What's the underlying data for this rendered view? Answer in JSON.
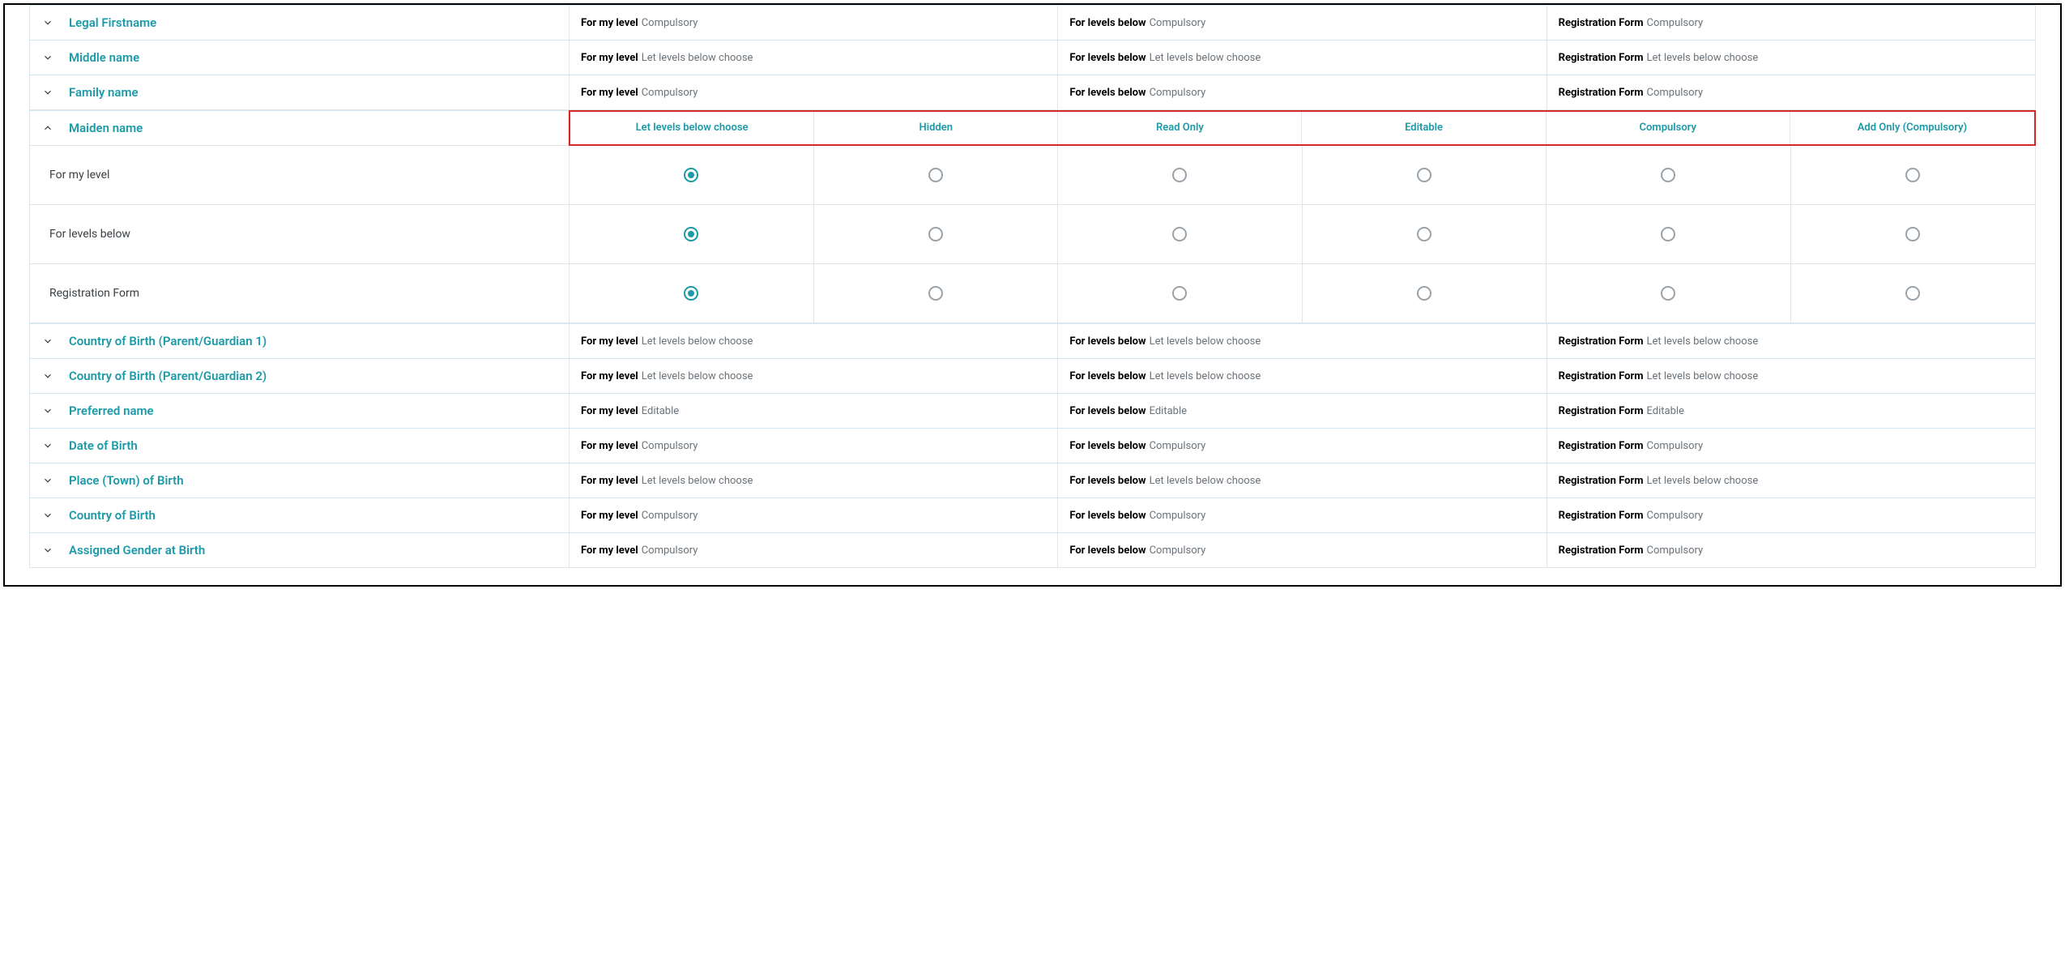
{
  "summaryLabels": {
    "forMyLevel": "For my level",
    "forLevelsBelow": "For levels below",
    "registrationForm": "Registration Form"
  },
  "optionHeaders": [
    "Let levels below choose",
    "Hidden",
    "Read Only",
    "Editable",
    "Compulsory",
    "Add Only (Compulsory)"
  ],
  "rowsBefore": [
    {
      "name": "Legal Firstname",
      "values": {
        "forMyLevel": "Compulsory",
        "forLevelsBelow": "Compulsory",
        "registrationForm": "Compulsory"
      }
    },
    {
      "name": "Middle name",
      "values": {
        "forMyLevel": "Let levels below choose",
        "forLevelsBelow": "Let levels below choose",
        "registrationForm": "Let levels below choose"
      }
    },
    {
      "name": "Family name",
      "values": {
        "forMyLevel": "Compulsory",
        "forLevelsBelow": "Compulsory",
        "registrationForm": "Compulsory"
      }
    }
  ],
  "expanded": {
    "name": "Maiden name",
    "rows": [
      {
        "label": "For my level",
        "selectedIndex": 0
      },
      {
        "label": "For levels below",
        "selectedIndex": 0
      },
      {
        "label": "Registration Form",
        "selectedIndex": 0
      }
    ]
  },
  "rowsAfter": [
    {
      "name": "Country of Birth (Parent/Guardian 1)",
      "values": {
        "forMyLevel": "Let levels below choose",
        "forLevelsBelow": "Let levels below choose",
        "registrationForm": "Let levels below choose"
      }
    },
    {
      "name": "Country of Birth (Parent/Guardian 2)",
      "values": {
        "forMyLevel": "Let levels below choose",
        "forLevelsBelow": "Let levels below choose",
        "registrationForm": "Let levels below choose"
      }
    },
    {
      "name": "Preferred name",
      "values": {
        "forMyLevel": "Editable",
        "forLevelsBelow": "Editable",
        "registrationForm": "Editable"
      }
    },
    {
      "name": "Date of Birth",
      "values": {
        "forMyLevel": "Compulsory",
        "forLevelsBelow": "Compulsory",
        "registrationForm": "Compulsory"
      }
    },
    {
      "name": "Place (Town) of Birth",
      "values": {
        "forMyLevel": "Let levels below choose",
        "forLevelsBelow": "Let levels below choose",
        "registrationForm": "Let levels below choose"
      }
    },
    {
      "name": "Country of Birth",
      "values": {
        "forMyLevel": "Compulsory",
        "forLevelsBelow": "Compulsory",
        "registrationForm": "Compulsory"
      }
    },
    {
      "name": "Assigned Gender at Birth",
      "values": {
        "forMyLevel": "Compulsory",
        "forLevelsBelow": "Compulsory",
        "registrationForm": "Compulsory"
      }
    }
  ]
}
